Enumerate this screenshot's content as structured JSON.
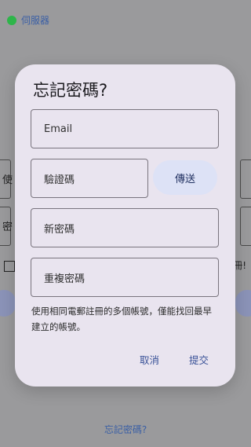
{
  "status": {
    "server_label": "伺服器",
    "dot_color": "#2eb54a"
  },
  "background": {
    "field_initial_1": "使",
    "field_initial_2": "密",
    "checkbox_trail": "冊!",
    "forgot_link": "忘記密碼?"
  },
  "dialog": {
    "title": "忘記密碼?",
    "email_label": "Email",
    "code_label": "驗證碼",
    "send_button": "傳送",
    "new_password_label": "新密碼",
    "repeat_password_label": "重複密碼",
    "note": "使用相同電郵註冊的多個帳號，僅能找回最早建立的帳號。",
    "cancel_button": "取消",
    "submit_button": "提交"
  },
  "colors": {
    "accent": "#3a5298",
    "send_bg": "#dde2f6",
    "dialog_bg": "#e9e4ef"
  }
}
